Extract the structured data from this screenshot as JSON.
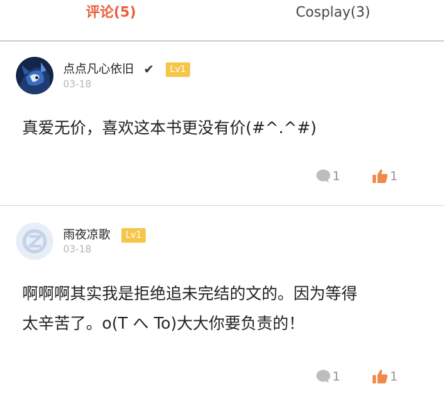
{
  "tabs": [
    {
      "label": "评论(5)",
      "active": true
    },
    {
      "label": "Cosplay(3)",
      "active": false
    }
  ],
  "colors": {
    "accent": "#e8603c",
    "level_badge": "#f5c64a",
    "like": "#f08a4b"
  },
  "comments": [
    {
      "username": "点点凡心依旧",
      "verified_mark": "✔",
      "level": "Lv1",
      "date": "03-18",
      "text": "真爱无价，喜欢这本书更没有价(#^.^#)",
      "reply_count": "1",
      "like_count": "1",
      "avatar_icon": "dark-anime-avatar"
    },
    {
      "username": "雨夜凉歌",
      "level": "Lv1",
      "date": "03-18",
      "text_lines": [
        "啊啊啊其实我是拒绝追未完结的文的。因为等得",
        "太辛苦了。o(T へ To)大大你要负责的！"
      ],
      "reply_count": "1",
      "like_count": "1",
      "avatar_icon": "default-qq-avatar"
    }
  ]
}
